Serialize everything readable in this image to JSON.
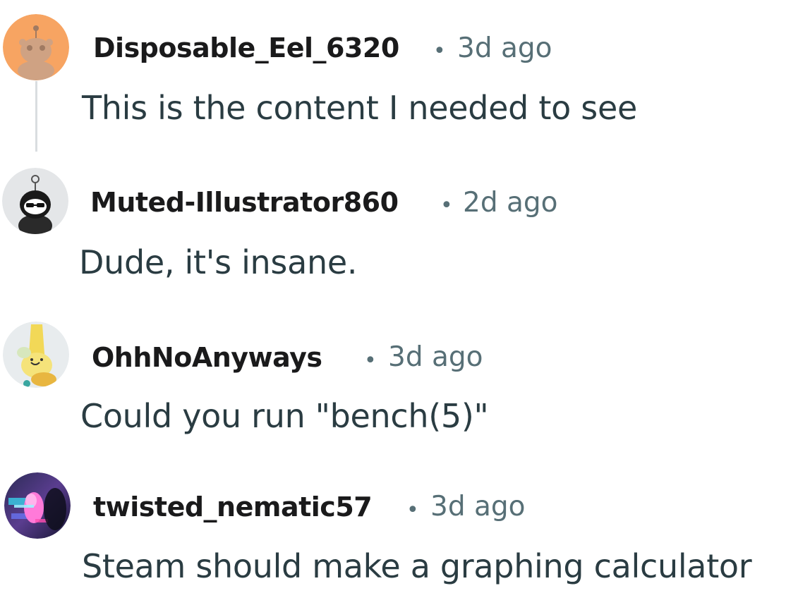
{
  "comments": [
    {
      "username": "Disposable_Eel_6320",
      "separator": "•",
      "timestamp": "3d ago",
      "body": "This is the content I needed to see",
      "avatar_icon": "snoo-avatar-orange"
    },
    {
      "username": "Muted-Illustrator860",
      "separator": "•",
      "timestamp": "2d ago",
      "body": "Dude, it's insane.",
      "avatar_icon": "snoo-avatar-sunglasses"
    },
    {
      "username": "OhhNoAnyways",
      "separator": "•",
      "timestamp": "3d ago",
      "body": "Could you run \"bench(5)\"",
      "avatar_icon": "snoo-avatar-banana"
    },
    {
      "username": "twisted_nematic57",
      "separator": "•",
      "timestamp": "3d ago",
      "body": "Steam should make a graphing calculator",
      "avatar_icon": "snoo-avatar-glitch"
    }
  ],
  "colors": {
    "username": "#1a1a1b",
    "timestamp": "#576f76",
    "body": "#2a3c42",
    "thread_line": "#d9dde0"
  }
}
